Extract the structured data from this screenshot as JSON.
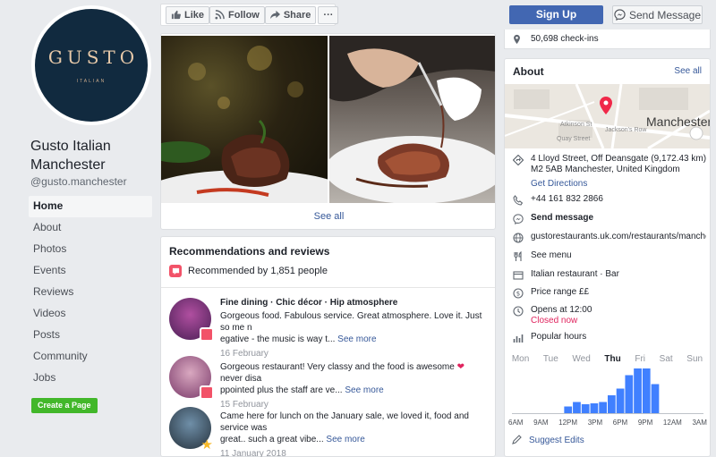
{
  "page": {
    "logo_text": "GUSTO",
    "logo_sub": "ITALIAN",
    "name": "Gusto Italian Manchester",
    "handle": "@gusto.manchester"
  },
  "nav": {
    "items": [
      "Home",
      "About",
      "Photos",
      "Events",
      "Reviews",
      "Videos",
      "Posts",
      "Community",
      "Jobs"
    ],
    "create_page": "Create a Page"
  },
  "actions": {
    "like": "Like",
    "follow": "Follow",
    "share": "Share",
    "more": "···",
    "signup": "Sign Up",
    "send_message": "Send Message"
  },
  "photos": {
    "see_all": "See all"
  },
  "recommendations": {
    "title": "Recommendations and reviews",
    "count_text": "Recommended by 1,851 people",
    "see_more": "See more",
    "reviews": [
      {
        "tags": "Fine dining · Chic décor · Hip atmosphere",
        "text_line1": "Gorgeous food. Fabulous service. Great atmosphere. Love it. Just so me n",
        "text_line2": "egative - the music is way t...",
        "date": "16 February"
      },
      {
        "tags": "",
        "text_line1a": "Gorgeous restaurant! Very classy and the food is awesome",
        "heart": "❤",
        "text_line1b": "never disa",
        "text_line2": "ppointed plus the staff are ve...",
        "date": "15 February"
      },
      {
        "tags": "",
        "text_line1": "Came here for lunch on the January sale, we loved it, food and service was",
        "text_line2": "great.. such a great vibe...",
        "date": "11 January 2018"
      }
    ]
  },
  "about": {
    "checkins": "50,698 check-ins",
    "title": "About",
    "see_all": "See all",
    "map_city": "Manchester",
    "map_streets": [
      "Atkinson St",
      "Jackson's Row",
      "Quay Street"
    ],
    "address_line1": "4 Lloyd Street, Off Deansgate (9,172.43 km)",
    "address_line2": "M2 5AB Manchester, United Kingdom",
    "directions": "Get Directions",
    "phone": "+44 161 832 2866",
    "send_message": "Send message",
    "website": "gustorestaurants.uk.com/restaurants/manchester",
    "menu": "See menu",
    "category": "Italian restaurant · Bar",
    "price": "Price range ££",
    "opens": "Opens at 12:00",
    "closed": "Closed now",
    "popular_hours": "Popular hours",
    "days": [
      "Mon",
      "Tue",
      "Wed",
      "Thu",
      "Fri",
      "Sat",
      "Sun"
    ],
    "hour_labels": [
      "6AM",
      "9AM",
      "12PM",
      "3PM",
      "6PM",
      "9PM",
      "12AM",
      "3AM"
    ],
    "suggest_edits": "Suggest Edits"
  },
  "chart_data": {
    "type": "bar",
    "title": "Popular hours",
    "day": "Thu",
    "hours": [
      "6AM",
      "7AM",
      "8AM",
      "9AM",
      "10AM",
      "11AM",
      "12PM",
      "1PM",
      "2PM",
      "3PM",
      "4PM",
      "5PM",
      "6PM",
      "7PM",
      "8PM",
      "9PM",
      "10PM",
      "11PM",
      "12AM",
      "1AM",
      "2AM",
      "3AM"
    ],
    "values": [
      0,
      0,
      0,
      0,
      0,
      0,
      15,
      25,
      20,
      22,
      25,
      40,
      55,
      85,
      100,
      100,
      65,
      0,
      0,
      0,
      0,
      0
    ],
    "ylim": [
      0,
      100
    ],
    "color": "#4080ff"
  }
}
